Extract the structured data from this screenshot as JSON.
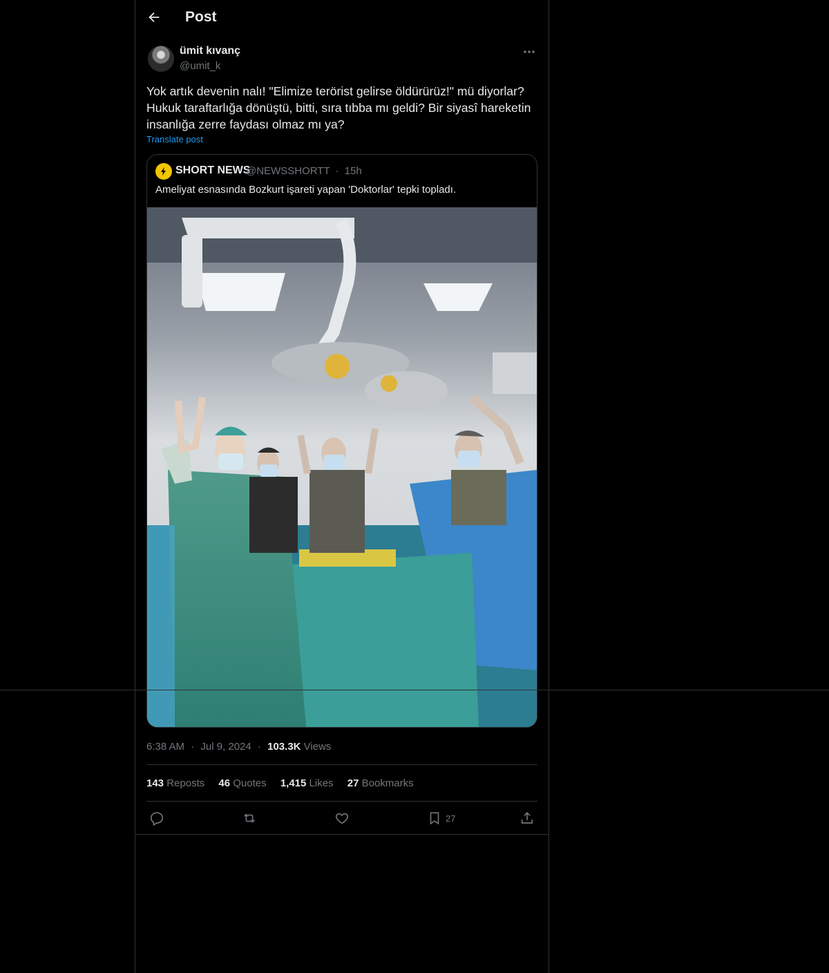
{
  "header": {
    "title": "Post",
    "back_icon": "arrow-left-icon"
  },
  "post": {
    "display_name": "ümit kıvanç",
    "handle": "@umit_k",
    "text_lines": [
      "Yok artık devenin nalı! \"Elimize terörist gelirse öldürürüz!\" mü diyorlar?",
      "Hukuk taraftarlığa dönüştü, bitti, sıra tıbba mı geldi? Bir siyasî hareketin",
      "insanlığa zerre faydası olmaz mı ya?"
    ],
    "translate_label": "Translate post"
  },
  "quote": {
    "name": "SHORT NEWS",
    "handle": "@NEWSSHORTT",
    "dot": "·",
    "time": "15h",
    "text": "Ameliyat esnasında Bozkurt işareti yapan 'Doktorlar' tepki topladı."
  },
  "meta": {
    "time": "6:38 AM",
    "dot": "·",
    "date": "Jul 9, 2024",
    "views_count": "103.3K",
    "views_label": "Views"
  },
  "stats": {
    "reposts_count": "143",
    "reposts_label": "Reposts",
    "quotes_count": "46",
    "quotes_label": "Quotes",
    "likes_count": "1,415",
    "likes_label": "Likes",
    "bookmarks_count": "27",
    "bookmarks_label": "Bookmarks"
  },
  "actions": {
    "reply_icon": "reply-icon",
    "repost_icon": "repost-icon",
    "like_icon": "heart-icon",
    "bookmark_icon": "bookmark-icon",
    "bookmark_count": "27",
    "share_icon": "share-icon"
  },
  "colors": {
    "background": "#000000",
    "text": "#e7e9ea",
    "muted": "#71767b",
    "accent": "#1d9bf0",
    "border": "#2f3336"
  }
}
